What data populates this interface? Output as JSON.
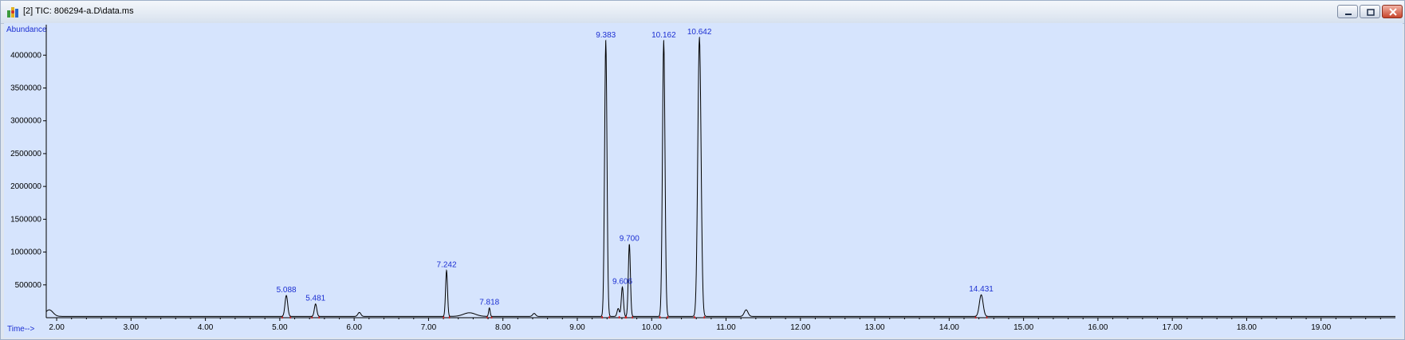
{
  "window": {
    "title": "[2] TIC: 806294-a.D\\data.ms",
    "app_icon": "chromatogram-app-icon",
    "controls": [
      "minimize-icon",
      "restore-icon",
      "close-icon"
    ]
  },
  "colors": {
    "plot_background": "#d6e4fd",
    "trace": "#000000",
    "peak_label": "#1c2fd2",
    "axis_label": "#1c2fd2",
    "baseline_marker": "#e02020"
  },
  "chart_data": {
    "type": "line",
    "ylabel": "Abundance",
    "xlabel": "Time-->",
    "xlim": [
      1.86,
      20.0
    ],
    "ylim": [
      0,
      4440000
    ],
    "grid": false,
    "x_ticks": [
      2.0,
      3.0,
      4.0,
      5.0,
      6.0,
      7.0,
      8.0,
      9.0,
      10.0,
      11.0,
      12.0,
      13.0,
      14.0,
      15.0,
      16.0,
      17.0,
      18.0,
      19.0
    ],
    "x_tick_labels": [
      "2.00",
      "3.00",
      "4.00",
      "5.00",
      "6.00",
      "7.00",
      "8.00",
      "9.00",
      "10.00",
      "11.00",
      "12.00",
      "13.00",
      "14.00",
      "15.00",
      "16.00",
      "17.00",
      "18.00",
      "19.00"
    ],
    "y_ticks": [
      500000,
      1000000,
      1500000,
      2000000,
      2500000,
      3000000,
      3500000,
      4000000
    ],
    "y_tick_labels": [
      "500000",
      "1000000",
      "1500000",
      "2000000",
      "2500000",
      "3000000",
      "3500000",
      "4000000"
    ],
    "baseline": 20000,
    "peaks": [
      {
        "rt": 5.088,
        "label": "5.088",
        "height": 320000,
        "width": 0.018
      },
      {
        "rt": 5.481,
        "label": "5.481",
        "height": 190000,
        "width": 0.016
      },
      {
        "rt": 7.242,
        "label": "7.242",
        "height": 700000,
        "width": 0.013
      },
      {
        "rt": 7.818,
        "label": "7.818",
        "height": 130000,
        "width": 0.01
      },
      {
        "rt": 9.383,
        "label": "9.383",
        "height": 4200000,
        "width": 0.016
      },
      {
        "rt": 9.606,
        "label": "9.606",
        "height": 450000,
        "width": 0.014
      },
      {
        "rt": 9.7,
        "label": "9.700",
        "height": 1100000,
        "width": 0.014
      },
      {
        "rt": 10.162,
        "label": "10.162",
        "height": 4200000,
        "width": 0.017
      },
      {
        "rt": 10.642,
        "label": "10.642",
        "height": 4250000,
        "width": 0.022
      },
      {
        "rt": 14.431,
        "label": "14.431",
        "height": 330000,
        "width": 0.025
      }
    ],
    "minor_peaks": [
      {
        "rt": 1.9,
        "height": 100000,
        "width": 0.05
      },
      {
        "rt": 6.07,
        "height": 60000,
        "width": 0.02
      },
      {
        "rt": 7.55,
        "height": 55000,
        "width": 0.08
      },
      {
        "rt": 8.42,
        "height": 45000,
        "width": 0.02
      },
      {
        "rt": 9.55,
        "height": 120000,
        "width": 0.015
      },
      {
        "rt": 11.27,
        "height": 100000,
        "width": 0.025
      }
    ]
  }
}
